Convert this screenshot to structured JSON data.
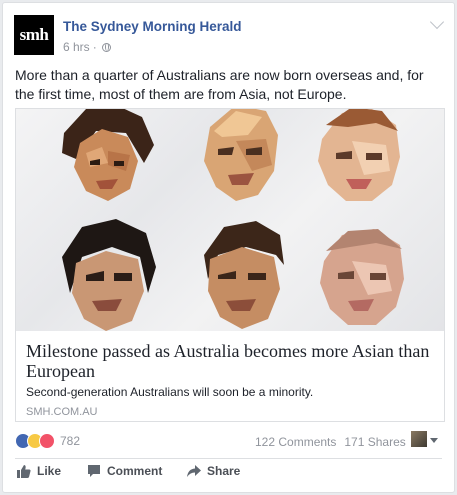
{
  "post": {
    "page_name": "The Sydney Morning Herald",
    "avatar_text": "smh",
    "time": "6 hrs",
    "separator": "·",
    "privacy_icon": "globe-icon",
    "text": "More than a quarter of Australians are now born overseas and, for the first time, most of them are from Asia, not Europe."
  },
  "link": {
    "title": "Milestone passed as Australia becomes more Asian than European",
    "description": "Second-generation Australians will soon be a minority.",
    "domain": "SMH.COM.AU"
  },
  "stats": {
    "reactions": [
      "like-icon",
      "wow-icon",
      "love-icon"
    ],
    "reaction_count": "782",
    "comments": "122 Comments",
    "shares": "171 Shares"
  },
  "actions": {
    "like": "Like",
    "comment": "Comment",
    "share": "Share"
  },
  "colors": {
    "link_blue": "#365899",
    "meta_gray": "#90949c",
    "like_blue": "#4267b2",
    "love_red": "#f25268",
    "wow_yellow": "#f7c944"
  }
}
